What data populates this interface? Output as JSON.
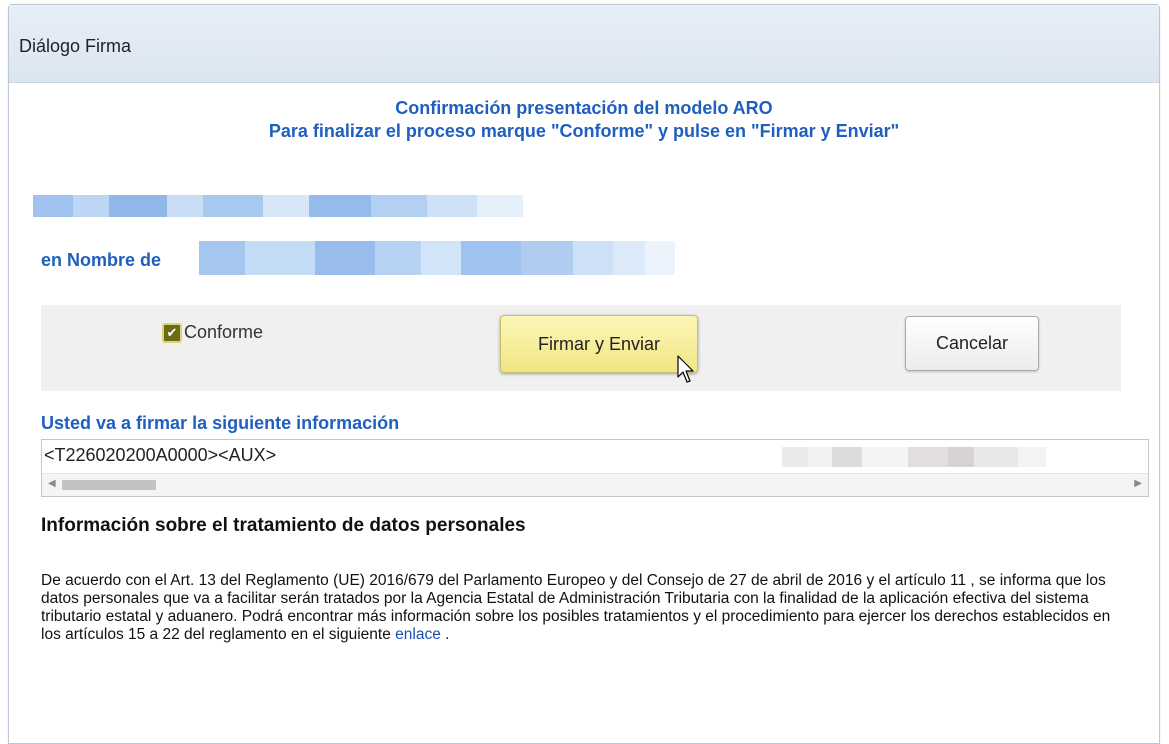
{
  "dialog": {
    "title": "Diálogo Firma",
    "heading_line1": "Confirmación presentación del modelo ARO",
    "heading_line2": "Para finalizar el proceso marque \"Conforme\" y pulse en \"Firmar y Enviar\"",
    "en_nombre_label": "en Nombre de"
  },
  "actions": {
    "conforme_label": "Conforme",
    "conforme_checked": true,
    "sign_button": "Firmar y Enviar",
    "cancel_button": "Cancelar"
  },
  "sign_info": {
    "label": "Usted va a firmar la siguiente información",
    "content": "<T226020200A0000><AUX>"
  },
  "privacy": {
    "title": "Información sobre el tratamiento de datos personales",
    "text": "De acuerdo con el Art. 13 del Reglamento (UE) 2016/679 del Parlamento Europeo y del Consejo de 27 de abril de 2016 y el artículo 11 , se informa que los datos personales que va a facilitar serán tratados por la Agencia Estatal de Administración Tributaria con la finalidad de la aplicación efectiva del sistema tributario estatal y aduanero. Podrá encontrar más información sobre los posibles tratamientos y el procedimiento para ejercer los derechos establecidos en los artículos 15 a 22 del reglamento en el siguiente",
    "link_text": "enlace",
    "tail": " ."
  },
  "colors": {
    "accent": "#1f5fbf",
    "titlebar_bg": "#dce6f1",
    "primary_button_bg": "#f1e684"
  },
  "icons": {
    "checkbox": "check-icon",
    "cursor": "mouse-pointer-icon",
    "scroll_left": "scroll-left-arrow-icon",
    "scroll_right": "scroll-right-arrow-icon"
  }
}
